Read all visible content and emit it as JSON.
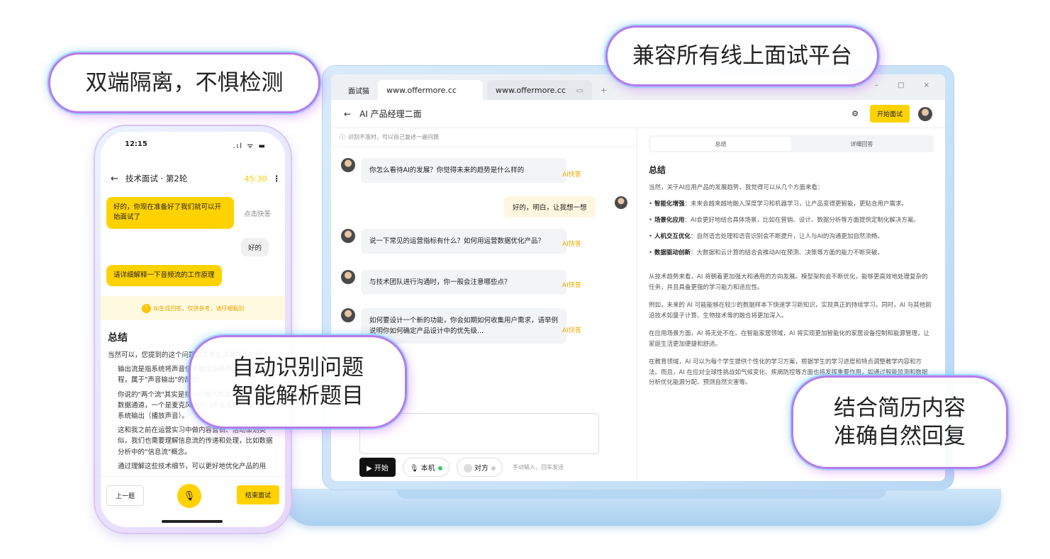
{
  "callouts": {
    "dual_isolation": "双端隔离，不惧检测",
    "compatible": "兼容所有线上面试平台",
    "auto_identify_l1": "自动识别问题",
    "auto_identify_l2": "智能解析题目",
    "resume_l1": "结合简历内容",
    "resume_l2": "准确自然回复"
  },
  "browser": {
    "app_tab": "面试猫",
    "url_tab_1": "www.offermore.cc",
    "url_tab_2": "www.offermore.cc",
    "new_tab": "+",
    "window_controls": "C – □ ×"
  },
  "desktop": {
    "back": "←",
    "title": "AI 产品经理二面",
    "start_button": "开始面试",
    "notice": "识别不准时，可以自己复述一遍问题",
    "questions": [
      {
        "text": "你怎么看待AI的发展？你觉得未来的趋势是什么样的",
        "ai": "AI快答"
      },
      {
        "text": "说一下常见的运营指标有什么？如何用运营数据优化产品？",
        "ai": "AI快答"
      },
      {
        "text": "与技术团队进行沟通时，你一般会注意哪些点？",
        "ai": "AI快答"
      },
      {
        "text": "如何要设计一个新的功能，你会如期如何收集用户需求，请举例说明你如何确定产品设计中的优先级...",
        "ai": "AI快答"
      }
    ],
    "self_reply": "好的，明白，让我想一想",
    "controls": {
      "start": "▶ 开始",
      "local": "本机",
      "remote": "对方",
      "hint": "手动输入，回车发送"
    },
    "right": {
      "tab_summary": "总结",
      "tab_detail": "详细回答",
      "heading": "总结",
      "intro": "当然，关于AI应用产品的发展趋势，我觉得可以从几个方面来看：",
      "bullets": [
        {
          "title": "智能化增强",
          "text": "：未来会越来越地融入深度学习和机器学习，让产品变得更智能，更贴合用户需求。"
        },
        {
          "title": "场景化应用",
          "text": "：AI会更好地结合具体场景，比如在营销、设计、数据分析等方面提供定制化解决方案。"
        },
        {
          "title": "人机交互优化",
          "text": "：自然语言处理和语音识别会不断提升，让人与AI的沟通更加自然流畅。"
        },
        {
          "title": "数据驱动创新",
          "text": "：大数据和云计算的结合会推动AI在预测、决策等方面的能力不断突破。"
        }
      ],
      "p1": "从技术趋势来看，AI 将朝着更加强大和通用的方向发展。模型架构会不断优化，能够更高效地处理复杂的任务，并且具备更强的学习能力和适应性。",
      "p2": "例如，未来的 AI 可能能够在较少的数据样本下快速学习新知识，实现真正的持续学习。同时，AI 与其他前沿技术如量子计算、生物技术等的融合将更加深入。",
      "p3": "在应用场景方面，AI 将无处不在。在智能家居领域，AI 将实现更加智能化的家居设备控制和能源管理，让家庭生活更加便捷和舒适。",
      "p4": "在教育领域，AI 可以为每个学生提供个性化的学习方案，根据学生的学习进度和特点调整教学内容和方法。而且，AI 在应对全球性挑战如气候变化、疾病防控等方面也将发挥重要作用，如通过智能监测和数据分析优化能源分配、预测自然灾害等。"
    }
  },
  "phone": {
    "time": "12:15",
    "signal": ".ıl ᯤ ▬",
    "back": "←",
    "title": "技术面试 · 第2轮",
    "timer": "45:30",
    "more": "⋮",
    "msg1": "好的，你现在准备好了我们就可以开始面试了",
    "quick": "点击快答",
    "reply": "好的",
    "msg2": "请详细解释一下音频流的工作原理",
    "notice": "AI生成回答，仅供参考，请仔细甄别",
    "heading": "总结",
    "p1": "当然可以，您提到的这个问题其实是在讲音频流的概念。",
    "p2": "输出流是指系统将声音信号输出到扬声器或耳机的过程，属于\"声音输出\"的部分。",
    "p3": "你说的\"两个流\"其实是指一个输入和输出两个不同的数据通道，一个是麦克风输入（声音采集），另一个是系统输出（播放声音）。",
    "p4": "这和我之前在运营实习中做内容营销、活动策划类似，我们也需要理解信息流的传递和处理，比如数据分析中的\"信息流\"概念。",
    "p5": "通过理解这些技术细节，可以更好地优化产品的用",
    "prev": "上一题",
    "end": "结束面试"
  }
}
